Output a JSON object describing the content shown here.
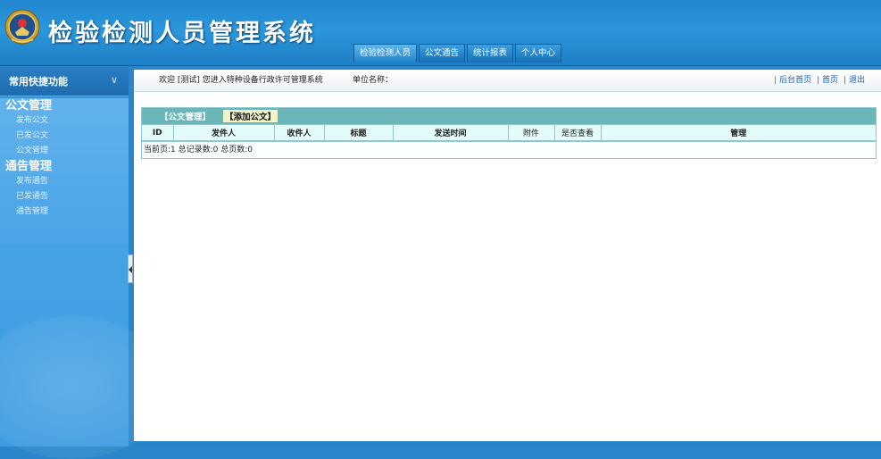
{
  "header": {
    "title": "检验检测人员管理系统",
    "logo_icon": "emblem-icon",
    "nav_tabs": [
      "检验检测人员",
      "公文通告",
      "统计报表",
      "个人中心"
    ]
  },
  "sidebar": {
    "heading": "常用快捷功能",
    "collapse_icon": "double-chevron-down-icon",
    "groups": [
      {
        "title": "公文管理",
        "items": [
          "发布公文",
          "已发公文",
          "公文管理"
        ]
      },
      {
        "title": "通告管理",
        "items": [
          "发布通告",
          "已发通告",
          "通告管理"
        ]
      }
    ]
  },
  "topbar": {
    "welcome": "欢迎 [测试] 您进入特种设备行政许可管理系统",
    "unit_label": "单位名称：",
    "links": [
      "后台首页",
      "首页",
      "退出"
    ]
  },
  "table": {
    "title": "【公文管理】",
    "add_button": "【添加公文】",
    "columns": [
      "ID",
      "发件人",
      "收件人",
      "标题",
      "发送时间",
      "附件",
      "是否查看",
      "管理"
    ],
    "pager": "当前页:1  总记录数:0  总页数:0"
  },
  "colors": {
    "header_blue": "#2c97dc",
    "table_title_teal": "#6bb6b9",
    "table_header_bg": "#e4fbfb",
    "link_blue": "#1a5fb4"
  }
}
